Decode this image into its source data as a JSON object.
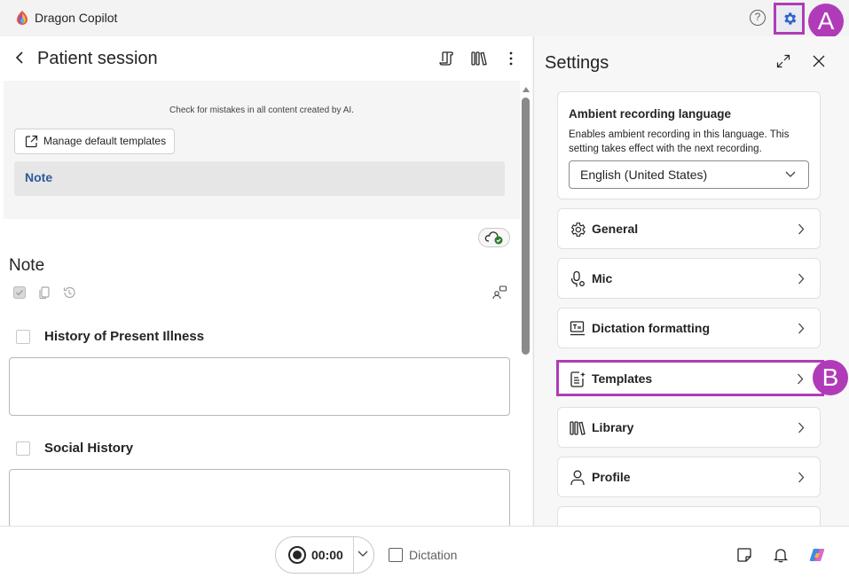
{
  "titlebar": {
    "app_title": "Dragon Copilot",
    "help_symbol": "?",
    "icons": [
      "dragon-copilot-logo",
      "help-icon",
      "settings-gear-icon"
    ]
  },
  "callouts": {
    "a": "A",
    "b": "B"
  },
  "session": {
    "title": "Patient session",
    "disclaimer": "Check for mistakes in all content created by AI.",
    "manage_templates_label": "Manage default templates",
    "note_tab_label": "Note",
    "note_heading": "Note",
    "sections": [
      {
        "title": "History of Present Illness",
        "value": ""
      },
      {
        "title": "Social History",
        "value": ""
      }
    ]
  },
  "settings": {
    "title": "Settings",
    "language": {
      "title": "Ambient recording language",
      "description": "Enables ambient recording in this language. This setting takes effect with the next recording.",
      "selected": "English (United States)"
    },
    "items": [
      {
        "label": "General",
        "icon": "gear-icon"
      },
      {
        "label": "Mic",
        "icon": "mic-settings-icon"
      },
      {
        "label": "Dictation formatting",
        "icon": "dictation-formatting-icon"
      },
      {
        "label": "Templates",
        "icon": "templates-icon"
      },
      {
        "label": "Library",
        "icon": "library-icon"
      },
      {
        "label": "Profile",
        "icon": "person-icon"
      }
    ]
  },
  "bottombar": {
    "timer": "00:00",
    "dictation_label": "Dictation",
    "dictation_checked": false
  },
  "colors": {
    "callout": "#b03bb8",
    "accent_blue": "#2a5a9b",
    "gear_blue": "#2b66c4"
  }
}
